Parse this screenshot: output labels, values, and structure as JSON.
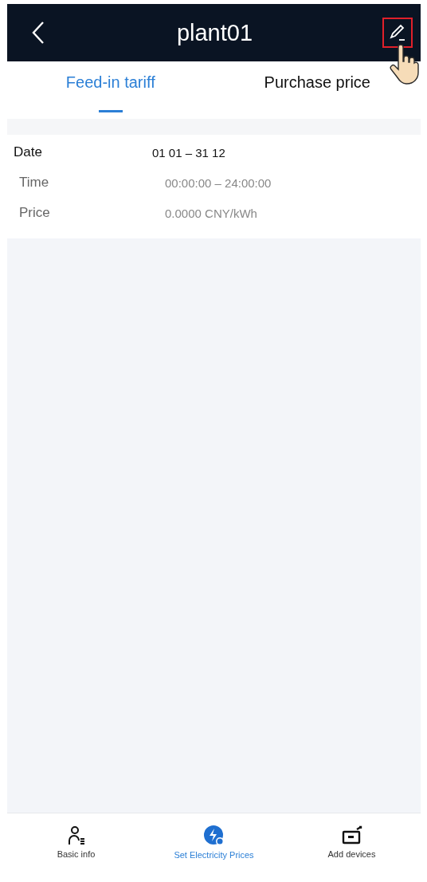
{
  "header": {
    "title": "plant01",
    "edit_highlighted": true
  },
  "tabs": [
    {
      "label": "Feed-in tariff",
      "selected": true
    },
    {
      "label": "Purchase price",
      "selected": false
    }
  ],
  "date": {
    "label": "Date",
    "value": "01 01 – 31 12"
  },
  "rows": [
    {
      "label": "Time",
      "value": "00:00:00 – 24:00:00"
    },
    {
      "label": "Price",
      "value": "0.0000 CNY/kWh"
    }
  ],
  "nav": [
    {
      "kind": "person",
      "label": "Basic info",
      "selected": false
    },
    {
      "kind": "price",
      "label": "Set Electricity Prices",
      "selected": true
    },
    {
      "kind": "device",
      "label": "Add devices",
      "selected": false
    }
  ]
}
